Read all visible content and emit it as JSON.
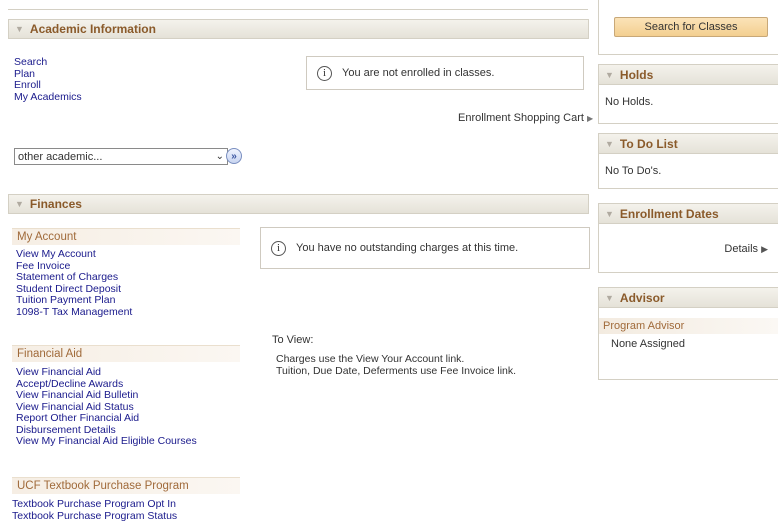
{
  "academic": {
    "title": "Academic Information",
    "links": [
      "Search",
      "Plan",
      "Enroll",
      "My Academics"
    ],
    "not_enrolled_msg": "You are not enrolled in classes.",
    "cart_link": "Enrollment Shopping Cart",
    "select_value": "other academic..."
  },
  "finances": {
    "title": "Finances",
    "my_account_header": "My Account",
    "my_account_links": [
      "View My Account",
      "Fee Invoice",
      "Statement of Charges",
      "Student Direct Deposit",
      "Tuition Payment Plan",
      "1098-T Tax Management"
    ],
    "financial_aid_header": "Financial Aid",
    "financial_aid_links": [
      "View Financial Aid",
      "Accept/Decline Awards",
      "View Financial Aid Bulletin",
      "View Financial Aid Status",
      "Report Other Financial Aid",
      "Disbursement Details",
      "View My Financial Aid Eligible Courses"
    ],
    "textbook_header": "UCF Textbook Purchase Program",
    "textbook_links": [
      "Textbook Purchase Program Opt In",
      "Textbook Purchase Program Status"
    ],
    "no_charges_msg": "You have no outstanding charges at this time.",
    "to_view_label": "To View:",
    "to_view_lines": [
      "Charges use the View Your Account link.",
      "Tuition, Due Date, Deferments use Fee Invoice link."
    ]
  },
  "right": {
    "search_button": "Search for Classes",
    "holds_title": "Holds",
    "holds_body": "No Holds.",
    "todo_title": "To Do List",
    "todo_body": "No To Do's.",
    "enroll_dates_title": "Enrollment Dates",
    "details_link": "Details",
    "advisor_title": "Advisor",
    "advisor_sub": "Program Advisor",
    "advisor_value": "None Assigned"
  }
}
